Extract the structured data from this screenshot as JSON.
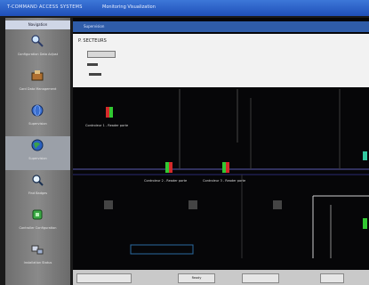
{
  "window": {
    "title": "T-COMMAND ACCESS SYSTEMS",
    "subtitle": "Monitoring Visualization"
  },
  "sidebar": {
    "header": "Navigation",
    "items": [
      {
        "label": "Configuration Data Adjust",
        "icon": "magnifier-icon"
      },
      {
        "label": "Card Data Management",
        "icon": "card-reader-icon"
      },
      {
        "label": "Supervision",
        "icon": "globe-icon"
      },
      {
        "label": "Supervision",
        "icon": "earth-icon",
        "selected": true
      },
      {
        "label": "Find Badges",
        "icon": "search-badge-icon"
      },
      {
        "label": "Controller Configuration",
        "icon": "controller-icon"
      },
      {
        "label": "Installation Status",
        "icon": "network-icon"
      }
    ]
  },
  "panel": {
    "header": "Supervision",
    "identifier": "P. SECTEURS",
    "doors": [
      {
        "label": "Controleur 1 - Reader porte",
        "state": "alarm"
      },
      {
        "label": "Controleur 2 - Reader porte",
        "state": "alarm"
      },
      {
        "label": "Controleur 3 - Reader porte",
        "state": "alarm"
      }
    ]
  },
  "status": {
    "cells": [
      "",
      "Ready",
      "",
      ""
    ]
  },
  "colors": {
    "titlebar": "#2b5fc7",
    "sidebar": "#7a7a7a",
    "plan_background": "#060608",
    "plan_lines": "#5a5ab0",
    "door_green": "#32c832",
    "door_red": "#d42a2a"
  }
}
